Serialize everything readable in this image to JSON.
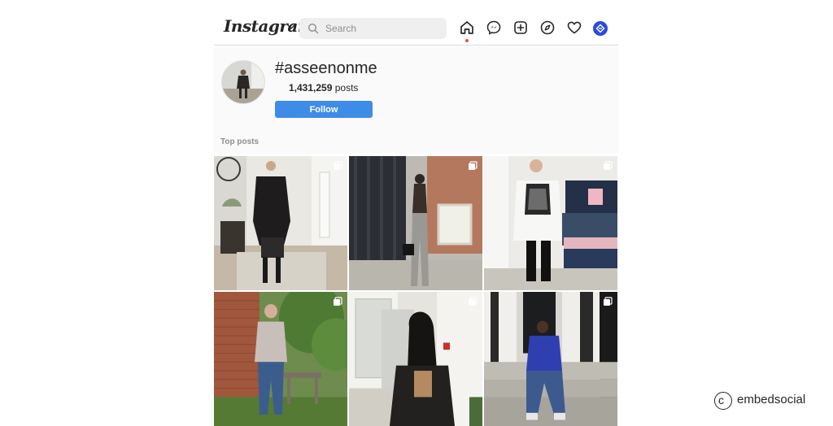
{
  "header": {
    "logo_text": "Instagram",
    "search_placeholder": "Search",
    "nav_icons": [
      "home-icon",
      "messenger-icon",
      "new-post-icon",
      "explore-icon",
      "activity-heart-icon",
      "profile-avatar-icon"
    ]
  },
  "hashtag": {
    "title": "#asseenonme",
    "post_count": "1,431,259",
    "post_count_suffix": " posts",
    "follow_label": "Follow"
  },
  "section": {
    "top_posts_label": "Top posts"
  },
  "posts": [
    {
      "name": "post-1",
      "multi": true
    },
    {
      "name": "post-2",
      "multi": true
    },
    {
      "name": "post-3",
      "multi": true
    },
    {
      "name": "post-4",
      "multi": true
    },
    {
      "name": "post-5",
      "multi": true
    },
    {
      "name": "post-6",
      "multi": true
    }
  ],
  "watermark": {
    "symbol": "c",
    "brand": "embedsocial"
  },
  "colors": {
    "follow_button": "#3f8ce8",
    "notification_dot": "#ed4956",
    "avatar": "#2c4bd8"
  }
}
